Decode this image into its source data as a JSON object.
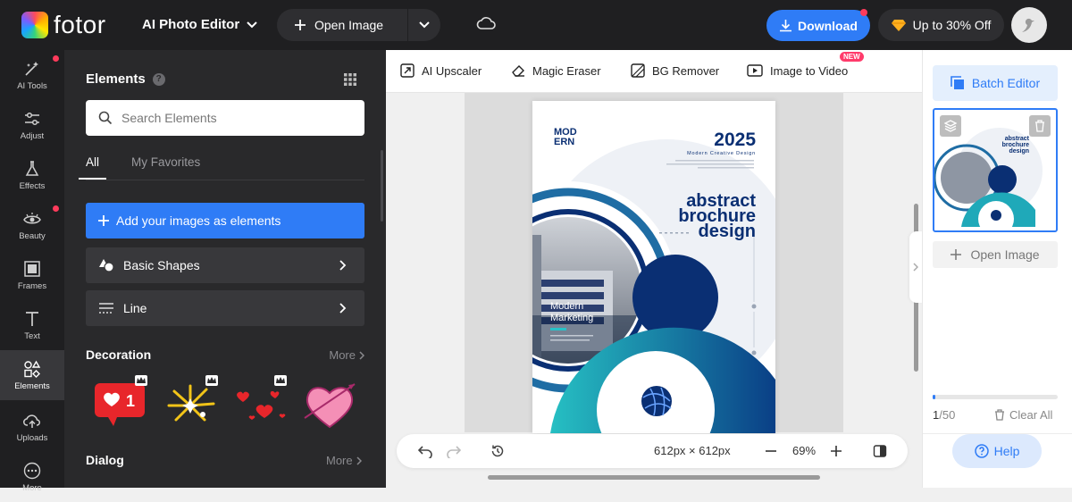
{
  "header": {
    "logo_text": "fotor",
    "editor_label": "AI Photo Editor",
    "open_image_label": "Open Image",
    "download_label": "Download",
    "promo_label": "Up to 30% Off"
  },
  "leftnav": {
    "items": [
      {
        "label": "AI Tools",
        "icon": "magic-wand-icon"
      },
      {
        "label": "Adjust",
        "icon": "sliders-icon"
      },
      {
        "label": "Effects",
        "icon": "flask-icon"
      },
      {
        "label": "Beauty",
        "icon": "eye-icon"
      },
      {
        "label": "Frames",
        "icon": "frame-icon"
      },
      {
        "label": "Text",
        "icon": "text-icon"
      },
      {
        "label": "Elements",
        "icon": "shapes-icon"
      },
      {
        "label": "Uploads",
        "icon": "cloud-upload-icon"
      },
      {
        "label": "More",
        "icon": "more-icon"
      }
    ]
  },
  "panel": {
    "title": "Elements",
    "search_placeholder": "Search Elements",
    "tabs": [
      "All",
      "My Favorites"
    ],
    "add_label": "Add your images as elements",
    "basic_shapes_label": "Basic Shapes",
    "line_label": "Line",
    "decoration_title": "Decoration",
    "dialog_title": "Dialog",
    "more_label": "More",
    "heart_badge_count": "1"
  },
  "toolbar": {
    "upscaler": "AI Upscaler",
    "eraser": "Magic Eraser",
    "bg_remover": "BG Remover",
    "image_to_video": "Image to Video",
    "new_badge": "NEW"
  },
  "poster": {
    "brand_line1": "MOD",
    "brand_line2": "ERN",
    "year": "2025",
    "subtitle": "Modern Creative Design",
    "headline1": "abstract",
    "headline2": "brochure",
    "headline3": "design",
    "photo_caption1": "Modern",
    "photo_caption2": "Marketing"
  },
  "bottombar": {
    "dimensions": "612px × 612px",
    "zoom": "69%"
  },
  "rightpanel": {
    "batch_label": "Batch Editor",
    "open_label": "Open Image",
    "count_current": "1",
    "count_total": "/50",
    "clear_label": "Clear All",
    "help_label": "Help",
    "progress": 0.02
  },
  "colors": {
    "accent": "#2f7cf6",
    "dark_bg": "#1f1f21",
    "panel_bg": "#29292b",
    "navy": "#0a2f73",
    "teal": "#1fb5bf"
  }
}
